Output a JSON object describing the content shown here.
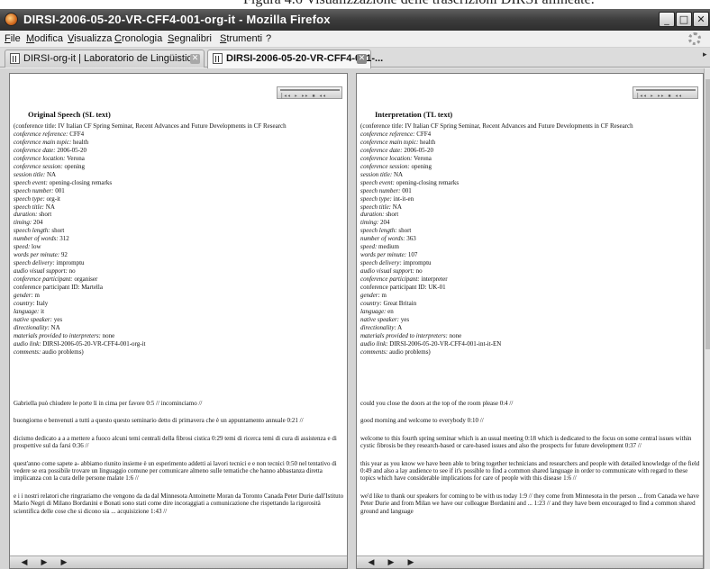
{
  "caption": "Figura 4.6 Visualizzazione delle trascrizioni DIRSI allineate.",
  "window": {
    "title": "DIRSI-2006-05-20-VR-CFF4-001-org-it - Mozilla Firefox",
    "buttons": {
      "minimize": "_",
      "maximize": "□",
      "close": "✕"
    }
  },
  "menu": [
    "File",
    "Modifica",
    "Visualizza",
    "Cronologia",
    "Segnalibri",
    "Strumenti",
    "?"
  ],
  "tabs": [
    {
      "label": "DIRSI-org-it | Laboratorio de Lingüistic...",
      "close": "✕",
      "active": false
    },
    {
      "label": "DIRSI-2006-05-20-VR-CFF4-001-...",
      "close": "✕",
      "active": true
    }
  ],
  "tab_scroll_glyph": "▸",
  "mini_player_buttons": "|◂◂ ▸ ▸▸ ▪ ◂◂",
  "player_buttons": {
    "prev": "◀",
    "play": "▶",
    "next": "▶"
  },
  "left": {
    "title": "Original Speech (SL text)",
    "meta": [
      {
        "k": "",
        "v": "(conference title: IV Italian CF Spring Seminar, Recent Advances and Future Developments in CF Research"
      },
      {
        "k": "conference reference:",
        "v": " CFF4"
      },
      {
        "k": "conference main topic:",
        "v": " health"
      },
      {
        "k": "conference date:",
        "v": " 2006-05-20"
      },
      {
        "k": "conference location:",
        "v": " Verona"
      },
      {
        "k": "conference session:",
        "v": " opening"
      },
      {
        "k": "session title:",
        "v": " NA"
      },
      {
        "k": "speech event:",
        "v": " opening-closing remarks"
      },
      {
        "k": "speech number:",
        "v": " 001"
      },
      {
        "k": "speech type:",
        "v": " org-it"
      },
      {
        "k": "speech title:",
        "v": " NA"
      },
      {
        "k": "duration:",
        "v": " short"
      },
      {
        "k": "timing:",
        "v": " 204"
      },
      {
        "k": "speech length:",
        "v": " short"
      },
      {
        "k": "number of words:",
        "v": " 312"
      },
      {
        "k": "speed:",
        "v": " low"
      },
      {
        "k": "words per minute:",
        "v": " 92"
      },
      {
        "k": "speech delivery:",
        "v": " impromptu"
      },
      {
        "k": "audio visual support:",
        "v": " no"
      },
      {
        "k": "conference participant:",
        "v": " organiser"
      },
      {
        "k": "",
        "v": "conference participant ID: Martella"
      },
      {
        "k": "gender:",
        "v": " m"
      },
      {
        "k": "country:",
        "v": " Italy"
      },
      {
        "k": "language:",
        "v": " it"
      },
      {
        "k": "native speaker:",
        "v": " yes"
      },
      {
        "k": "directionality:",
        "v": " NA"
      },
      {
        "k": "materials provided to interpreters:",
        "v": " none"
      },
      {
        "k": "audio link:",
        "v": " DIRSI-2006-05-20-VR-CFF4-001-org-it"
      },
      {
        "k": "comments:",
        "v": " audio problems)"
      }
    ],
    "segments": [
      "Gabriella può chiudere le porte lì in cima per favore 0:5 // incominciamo //",
      "buongiorno e benvenuti a tutti a questo questo seminario detto di primavera che è un appuntamento annuale 0:21 //",
      "dicismo dedicato a a a mettere a fuoco alcuni temi centrali della fibrosi cistica 0:29 temi di ricerca temi di cura di assistenza e di prospettive sul da farsi 0:36 //",
      "quest'anno come sapete a- abbiamo riunito insieme è un esperimento addetti ai lavori tecnici e e non tecnici 0:50 nel tentativo di vedere se era possibile trovare un linguaggio comune per comunicare almeno sulle tematiche che hanno abbastanza diretta implicanza con la cura delle persone malate 1:6 //",
      "e i i nostri relatori che ringraziamo che vengono da da dal Minnesota Antoinette Moran da Toronto Canada Peter Durie dall'Istituto Mario Negri di Milano Bordanini e Bonati sono stati come dire incoraggiati a comunicazione che rispettando la rigorosità scientifica delle cose che si dicono sia ... acquisizione 1:43 //"
    ]
  },
  "right": {
    "title": "Interpretation (TL text)",
    "meta": [
      {
        "k": "",
        "v": "(conference title: IV Italian CF Spring Seminar, Recent Advances and Future Developments in CF Research"
      },
      {
        "k": "conference reference:",
        "v": " CFF4"
      },
      {
        "k": "conference main topic:",
        "v": " health"
      },
      {
        "k": "conference date:",
        "v": " 2006-05-20"
      },
      {
        "k": "conference location:",
        "v": " Verona"
      },
      {
        "k": "conference session:",
        "v": " opening"
      },
      {
        "k": "session title:",
        "v": " NA"
      },
      {
        "k": "speech event:",
        "v": " opening-closing remarks"
      },
      {
        "k": "speech number:",
        "v": " 001"
      },
      {
        "k": "speech type:",
        "v": " int-it-en"
      },
      {
        "k": "speech title:",
        "v": " NA"
      },
      {
        "k": "duration:",
        "v": " short"
      },
      {
        "k": "timing:",
        "v": " 204"
      },
      {
        "k": "speech length:",
        "v": " short"
      },
      {
        "k": "number of words:",
        "v": " 363"
      },
      {
        "k": "speed:",
        "v": " medium"
      },
      {
        "k": "words per minute:",
        "v": " 107"
      },
      {
        "k": "speech delivery:",
        "v": " impromptu"
      },
      {
        "k": "audio visual support:",
        "v": " no"
      },
      {
        "k": "conference participant:",
        "v": " interpreter"
      },
      {
        "k": "",
        "v": "conference participant ID: UK-01"
      },
      {
        "k": "gender:",
        "v": " m"
      },
      {
        "k": "country:",
        "v": " Great Britain"
      },
      {
        "k": "language:",
        "v": " en"
      },
      {
        "k": "native speaker:",
        "v": " yes"
      },
      {
        "k": "directionality:",
        "v": " A"
      },
      {
        "k": "materials provided to interpreters:",
        "v": " none"
      },
      {
        "k": "audio link:",
        "v": " DIRSI-2006-05-20-VR-CFF4-001-int-it-EN"
      },
      {
        "k": "comments:",
        "v": " audio problems)"
      }
    ],
    "segments": [
      "could you close the doors at the top of the room please 0:4 //",
      "good morning and welcome to everybody 0:10 //",
      "welcome to this fourth spring seminar which is an usual meeting 0:18 which is dedicated to the focus on some central issues within cystic fibrosis be they research-based or care-based issues and also the prospects for future development 0:37 //",
      "this year as you know we have been able to bring together technicians and researchers and people with detailed knowledge of the field 0:49 and also a lay audience to see if it's possible to find a common shared language in order to communicate with regard to these topics which have considerable implications for care of people with this disease 1:6 //",
      "we'd like to thank our speakers for coming to be with us today 1:9 // they come from Minnesota in the person ... from Canada we have Peter Durie and from Milan we have our colleague Bordanini and ... 1:23 // and they have been encouraged to find a common shared ground and language"
    ]
  }
}
